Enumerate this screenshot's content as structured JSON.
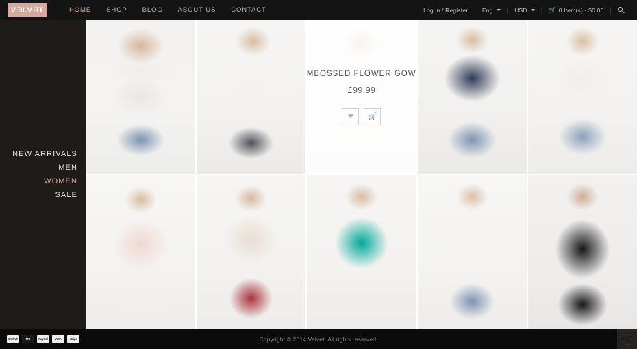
{
  "header": {
    "logo": {
      "text": "VELVET",
      "bg_color": "#d6a99d"
    },
    "nav": [
      {
        "label": "HOME",
        "active": true
      },
      {
        "label": "SHOP",
        "active": false
      },
      {
        "label": "BLOG",
        "active": false
      },
      {
        "label": "ABOUT US",
        "active": false
      },
      {
        "label": "CONTACT",
        "active": false
      }
    ],
    "toolbar": {
      "account": "Log in / Register",
      "language": "Eng",
      "currency": "USD",
      "cart": "0 Item(s) - $0.00",
      "search_icon": "search-icon",
      "separator": "|"
    }
  },
  "sidebar": {
    "menu": [
      {
        "label": "NEW ARRIVALS",
        "active": false
      },
      {
        "label": "MEN",
        "active": false
      },
      {
        "label": "WOMEN",
        "active": true
      },
      {
        "label": "SALE",
        "active": false
      }
    ],
    "accent_color": "#d9a99b"
  },
  "grid": {
    "items": [
      {
        "name": "product-tile-1",
        "hovered": false
      },
      {
        "name": "product-tile-2",
        "hovered": false
      },
      {
        "name": "product-tile-3",
        "hovered": true,
        "title": "EMBOSSED FLOWER GOWN",
        "price": "£99.99",
        "wishlist_icon": "heart-icon",
        "cart_icon": "cart-icon"
      },
      {
        "name": "product-tile-4",
        "hovered": false
      },
      {
        "name": "product-tile-5",
        "hovered": false
      },
      {
        "name": "product-tile-6",
        "hovered": false
      },
      {
        "name": "product-tile-7",
        "hovered": false
      },
      {
        "name": "product-tile-8",
        "hovered": false
      },
      {
        "name": "product-tile-9",
        "hovered": false
      },
      {
        "name": "product-tile-10",
        "hovered": false
      }
    ]
  },
  "footer": {
    "payment_methods": [
      {
        "label": "DISCVR"
      },
      {
        "label": "MC"
      },
      {
        "label": "PayPal"
      },
      {
        "label": "VISA"
      },
      {
        "label": "stripe"
      }
    ],
    "copyright": "Copyright © 2014 Velvet. All rights reserved.",
    "expand_icon": "plus-icon"
  }
}
